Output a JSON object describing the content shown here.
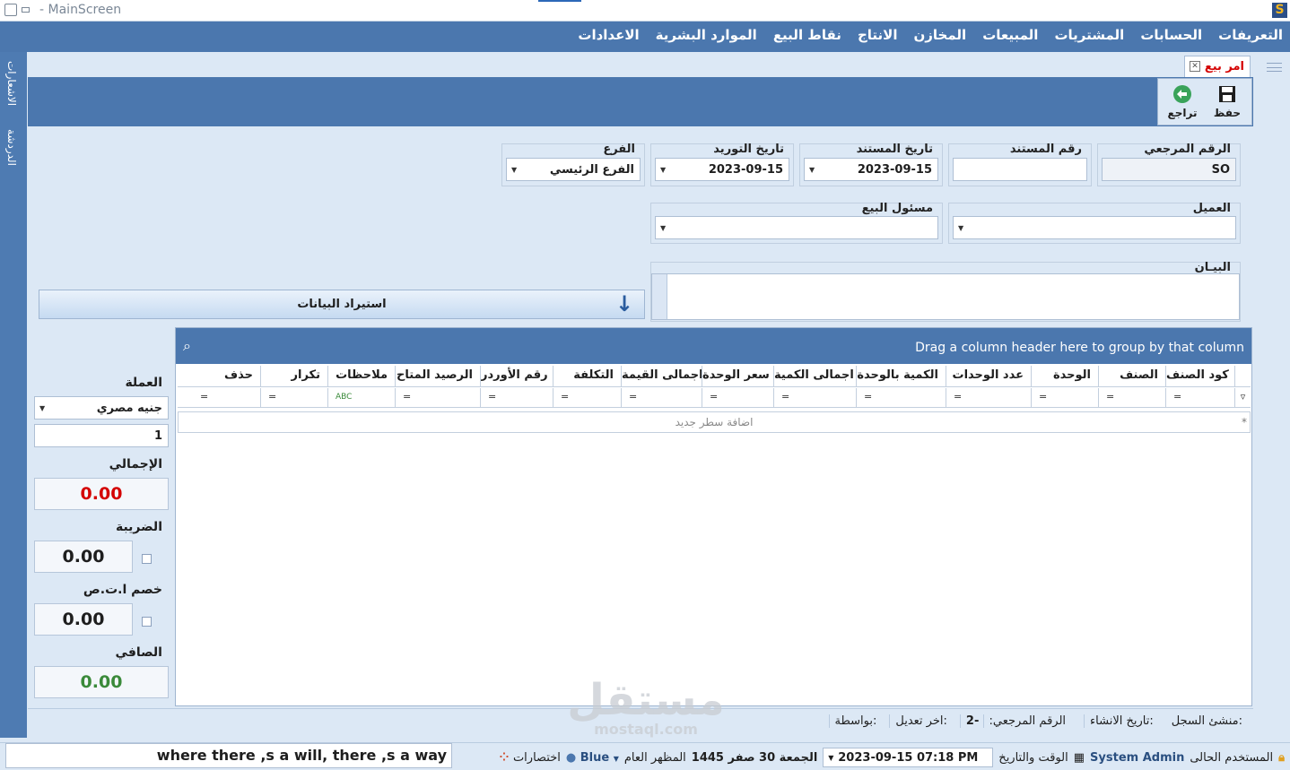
{
  "window": {
    "title": "MainScreen"
  },
  "menu": [
    "التعريفات",
    "الحسابات",
    "المشتريات",
    "المبيعات",
    "المخازن",
    "الانتاج",
    "نقاط البيع",
    "الموارد البشرية",
    "الاعدادات"
  ],
  "sidebar": {
    "tabs": [
      "الاشعارات",
      "الدردشة"
    ]
  },
  "tab": {
    "label": "امر بيع"
  },
  "toolbar": {
    "save_label": "حفظ",
    "back_label": "تراجع"
  },
  "form": {
    "ref_no": {
      "label": "الرقم المرجعي",
      "value": "SO"
    },
    "doc_no": {
      "label": "رقم المستند",
      "value": ""
    },
    "doc_date": {
      "label": "تاريخ المستند",
      "value": "2023-09-15"
    },
    "supply_date": {
      "label": "تاريخ التوريد",
      "value": "2023-09-15"
    },
    "branch": {
      "label": "الفرع",
      "value": "الفرع الرئيسي"
    },
    "customer": {
      "label": "العميل",
      "value": ""
    },
    "salesperson": {
      "label": "مسئول البيع",
      "value": ""
    },
    "notes": {
      "label": "البيـان",
      "value": ""
    },
    "import_label": "استيراد البيانات"
  },
  "grid": {
    "group_hint": "Drag a column header here to group by that column",
    "columns": [
      "كود الصنف",
      "الصنف",
      "الوحدة",
      "عدد الوحدات",
      "الكمية بالوحدة",
      "اجمالى الكمية",
      "سعر الوحدة",
      "اجمالى القيمة",
      "التكلفة",
      "رقم الأوردر",
      "الرصيد المتاح",
      "ملاحظات",
      "تكرار",
      "حذف"
    ],
    "new_row": "اضافة سطر جديد"
  },
  "totals": {
    "currency_label": "العملة",
    "currency": "جنيه مصري",
    "rate": "1",
    "total_label": "الإجمالي",
    "total": "0.00",
    "tax_label": "الضريبة",
    "tax": "0.00",
    "discount_label": "خصم ا.ت.ص",
    "discount": "0.00",
    "net_label": "الصافي",
    "net": "0.00",
    "colors": {
      "total": "#d40000",
      "net": "#3a8a3a"
    }
  },
  "record_footer": {
    "creator": "منشئ السجل:",
    "created": "تاريخ الانشاء:",
    "ref": "الرقم المرجعي:",
    "ref_val": "-2",
    "modified": "اخر تعديل:",
    "by": "بواسطة:"
  },
  "status": {
    "user_label": "المستخدم الحالى",
    "user": "System Admin",
    "datetime_label": "الوقت والتاريخ",
    "datetime": "2023-09-15 07:18 PM",
    "hijri": "الجمعة 30 صفر 1445",
    "theme_label": "المظهر العام",
    "theme": "Blue",
    "shortcuts": "اختصارات",
    "motto": "where there ,s a will, there ,s a way"
  },
  "watermark": {
    "text": "مستقل",
    "sub": "mostaql.com"
  }
}
